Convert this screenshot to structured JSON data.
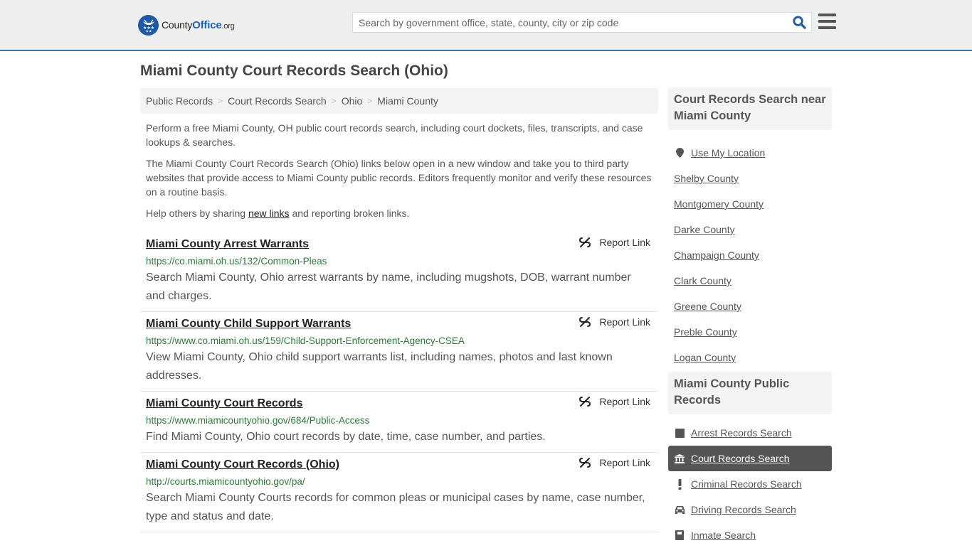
{
  "header": {
    "logo": {
      "brand_part1": "County",
      "brand_part2": "Office",
      "brand_suffix": ".org"
    },
    "search": {
      "placeholder": "Search by government office, state, county, city or zip code",
      "value": ""
    },
    "colors": {
      "accent": "#3a75a8",
      "brand_blue": "#1d5aa5"
    }
  },
  "page": {
    "title": "Miami County Court Records Search (Ohio)",
    "breadcrumb": [
      "Public Records",
      "Court Records Search",
      "Ohio",
      "Miami County"
    ],
    "intro": {
      "p1": "Perform a free Miami County, OH public court records search, including court dockets, files, transcripts, and case lookups & searches.",
      "p2": "The Miami County Court Records Search (Ohio) links below open in a new window and take you to third party websites that provide access to Miami County public records. Editors frequently monitor and verify these resources on a routine basis.",
      "p3_before": "Help others by sharing ",
      "p3_link": "new links",
      "p3_after": " and reporting broken links."
    },
    "report_label": "Report Link",
    "results": [
      {
        "title": "Miami County Arrest Warrants",
        "url": "https://co.miami.oh.us/132/Common-Pleas",
        "desc": "Search Miami County, Ohio arrest warrants by name, including mugshots, DOB, warrant number and charges."
      },
      {
        "title": "Miami County Child Support Warrants",
        "url": "https://www.co.miami.oh.us/159/Child-Support-Enforcement-Agency-CSEA",
        "desc": "View Miami County, Ohio child support warrants list, including names, photos and last known addresses."
      },
      {
        "title": "Miami County Court Records",
        "url": "https://www.miamicountyohio.gov/684/Public-Access",
        "desc": "Find Miami County, Ohio court records by date, time, case number, and parties."
      },
      {
        "title": "Miami County Court Records (Ohio)",
        "url": "http://courts.miamicountyohio.gov/pa/",
        "desc": "Search Miami County Courts records for common pleas or municipal cases by name, case number, type and status and date."
      }
    ]
  },
  "sidebar": {
    "nearby": {
      "heading": "Court Records Search near Miami County",
      "use_location": "Use My Location",
      "counties": [
        "Shelby County",
        "Montgomery County",
        "Darke County",
        "Champaign County",
        "Clark County",
        "Greene County",
        "Preble County",
        "Logan County"
      ]
    },
    "records": {
      "heading": "Miami County Public Records",
      "items": [
        {
          "label": "Arrest Records Search",
          "icon": "square-icon",
          "active": false
        },
        {
          "label": "Court Records Search",
          "icon": "courthouse-icon",
          "active": true
        },
        {
          "label": "Criminal Records Search",
          "icon": "exclamation-icon",
          "active": false
        },
        {
          "label": "Driving Records Search",
          "icon": "car-icon",
          "active": false
        },
        {
          "label": "Inmate Search",
          "icon": "inmate-icon",
          "active": false
        }
      ]
    }
  }
}
